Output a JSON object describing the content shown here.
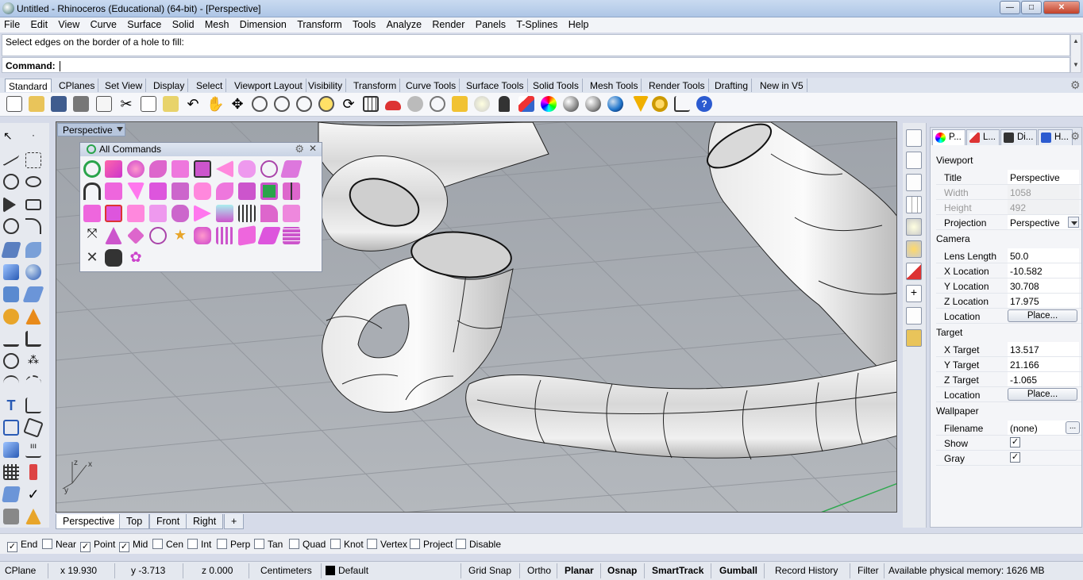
{
  "window": {
    "title": "Untitled - Rhinoceros (Educational) (64-bit) - [Perspective]"
  },
  "menu": [
    "File",
    "Edit",
    "View",
    "Curve",
    "Surface",
    "Solid",
    "Mesh",
    "Dimension",
    "Transform",
    "Tools",
    "Analyze",
    "Render",
    "Panels",
    "T-Splines",
    "Help"
  ],
  "command": {
    "history": "Select edges on the border of a hole to fill:",
    "prompt": "Command:",
    "value": ""
  },
  "toolbar_tabs": [
    "Standard",
    "CPlanes",
    "Set View",
    "Display",
    "Select",
    "Viewport Layout",
    "Visibility",
    "Transform",
    "Curve Tools",
    "Surface Tools",
    "Solid Tools",
    "Mesh Tools",
    "Render Tools",
    "Drafting",
    "New in V5"
  ],
  "toolbar_active_tab": "Standard",
  "viewport": {
    "name": "Perspective",
    "axis_x": "x",
    "axis_y": "y",
    "axis_z": "z"
  },
  "all_commands": {
    "title": "All Commands"
  },
  "view_tabs": [
    "Perspective",
    "Top",
    "Front",
    "Right"
  ],
  "properties": {
    "tabs": [
      "P...",
      "L...",
      "Di...",
      "H..."
    ],
    "viewport_section": "Viewport",
    "title_label": "Title",
    "title_value": "Perspective",
    "width_label": "Width",
    "width_value": "1058",
    "height_label": "Height",
    "height_value": "492",
    "projection_label": "Projection",
    "projection_value": "Perspective",
    "camera_section": "Camera",
    "lens_label": "Lens Length",
    "lens_value": "50.0",
    "xloc_label": "X Location",
    "xloc_value": "-10.582",
    "yloc_label": "Y Location",
    "yloc_value": "30.708",
    "zloc_label": "Z Location",
    "zloc_value": "17.975",
    "camloc_label": "Location",
    "camloc_button": "Place...",
    "target_section": "Target",
    "xtgt_label": "X Target",
    "xtgt_value": "13.517",
    "ytgt_label": "Y Target",
    "ytgt_value": "21.166",
    "ztgt_label": "Z Target",
    "ztgt_value": "-1.065",
    "tgtloc_label": "Location",
    "tgtloc_button": "Place...",
    "wallpaper_section": "Wallpaper",
    "filename_label": "Filename",
    "filename_value": "(none)",
    "filename_button": "...",
    "show_label": "Show",
    "show_checked": "✓",
    "gray_label": "Gray",
    "gray_checked": "✓"
  },
  "osnap": [
    {
      "label": "End",
      "checked": "✓"
    },
    {
      "label": "Near",
      "checked": ""
    },
    {
      "label": "Point",
      "checked": "✓"
    },
    {
      "label": "Mid",
      "checked": "✓"
    },
    {
      "label": "Cen",
      "checked": ""
    },
    {
      "label": "Int",
      "checked": ""
    },
    {
      "label": "Perp",
      "checked": ""
    },
    {
      "label": "Tan",
      "checked": ""
    },
    {
      "label": "Quad",
      "checked": ""
    },
    {
      "label": "Knot",
      "checked": ""
    },
    {
      "label": "Vertex",
      "checked": ""
    },
    {
      "label": "Project",
      "checked": ""
    },
    {
      "label": "Disable",
      "checked": ""
    }
  ],
  "status": {
    "cplane": "CPlane",
    "x": "x 19.930",
    "y": "y -3.713",
    "z": "z 0.000",
    "units": "Centimeters",
    "layer": "Default",
    "grid_snap": "Grid Snap",
    "ortho": "Ortho",
    "planar": "Planar",
    "osnap": "Osnap",
    "smarttrack": "SmartTrack",
    "gumball": "Gumball",
    "record_history": "Record History",
    "filter": "Filter",
    "memory": "Available physical memory: 1626 MB"
  },
  "window_buttons": {
    "minimize": "—",
    "maximize": "□",
    "close": "✕"
  }
}
